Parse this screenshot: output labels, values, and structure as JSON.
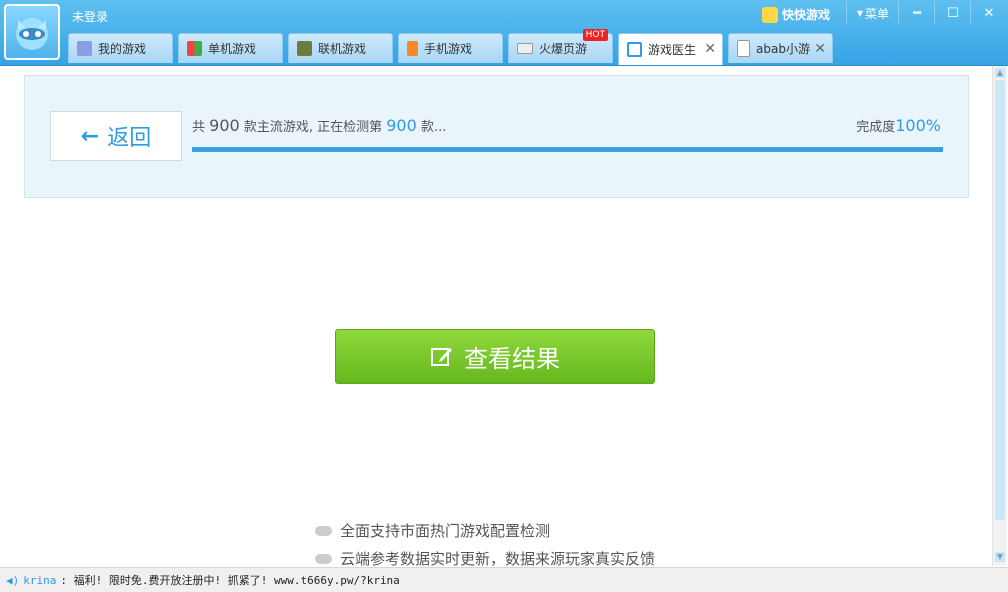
{
  "header": {
    "login_status": "未登录",
    "brand_name": "快快游戏",
    "menu_label": "菜单",
    "window_controls": [
      "minimize",
      "maximize",
      "close"
    ]
  },
  "tabs": [
    {
      "label": "我的游戏",
      "icon": "gamepad-icon",
      "active": false
    },
    {
      "label": "单机游戏",
      "icon": "blocks-icon",
      "active": false
    },
    {
      "label": "联机游戏",
      "icon": "cube-icon",
      "active": false
    },
    {
      "label": "手机游戏",
      "icon": "phone-icon",
      "active": false
    },
    {
      "label": "火爆页游",
      "icon": "controller-icon",
      "active": false,
      "badge": "HOT"
    },
    {
      "label": "游戏医生",
      "icon": "doctor-icon",
      "active": true,
      "closable": true
    },
    {
      "label": "abab小游",
      "icon": "page-icon",
      "active": false,
      "closable": true
    }
  ],
  "check": {
    "back_label": "返回",
    "text_prefix": "共",
    "total": "900",
    "text_middle": "款主流游戏, 正在检测第",
    "current": "900",
    "text_suffix": "款...",
    "completion_label": "完成度",
    "completion_value": "100%",
    "progress": 1.0
  },
  "main": {
    "result_button_label": "查看结果",
    "features": [
      "全面支持市面热门游戏配置检测",
      "云端参考数据实时更新，数据来源玩家真实反馈"
    ]
  },
  "statusbar": {
    "user": "krina",
    "message": ": 福利! 限时免.费开放注册中!  抓紧了! www.t666y.pw/?krina"
  },
  "colors": {
    "titlebar": "#35a3e6",
    "accent": "#2f9be0",
    "result_button": "#74c42a"
  }
}
